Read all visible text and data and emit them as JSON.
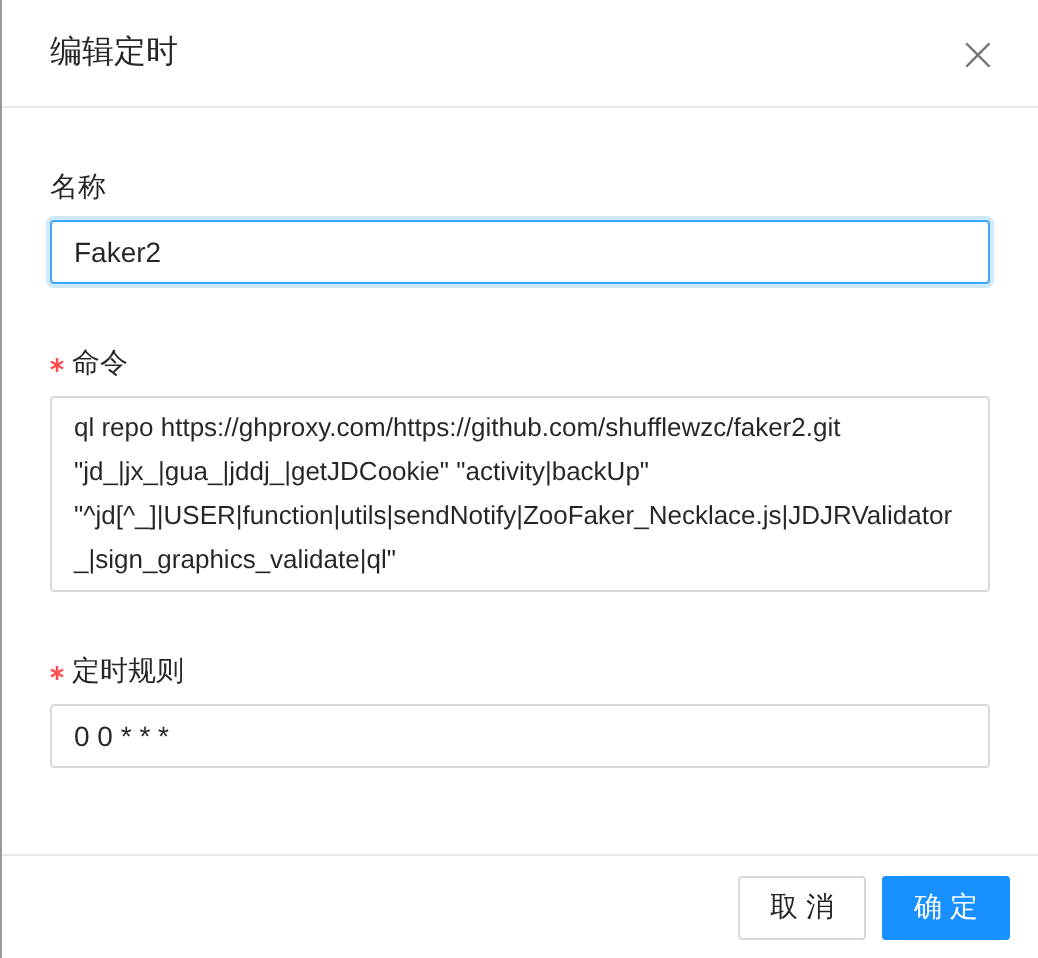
{
  "dialog": {
    "title": "编辑定时",
    "close": "×"
  },
  "fields": [
    {
      "kind": "input",
      "label": "名称",
      "required": false,
      "focused": true,
      "value": "Faker2"
    },
    {
      "kind": "textarea",
      "label": "命令",
      "required": true,
      "focused": false,
      "value": "ql repo https://ghproxy.com/https://github.com/shufflewzc/faker2.git \"jd_|jx_|gua_|jddj_|getJDCookie\" \"activity|backUp\" \"^jd[^_]|USER|function|utils|sendNotify|ZooFaker_Necklace.js|JDJRValidator_|sign_graphics_validate|ql\""
    },
    {
      "kind": "input",
      "label": "定时规则",
      "required": true,
      "focused": false,
      "value": "0 0 * * *"
    }
  ],
  "buttons": [
    {
      "label": "取 消",
      "kind": "default"
    },
    {
      "label": "确 定",
      "kind": "primary"
    }
  ]
}
